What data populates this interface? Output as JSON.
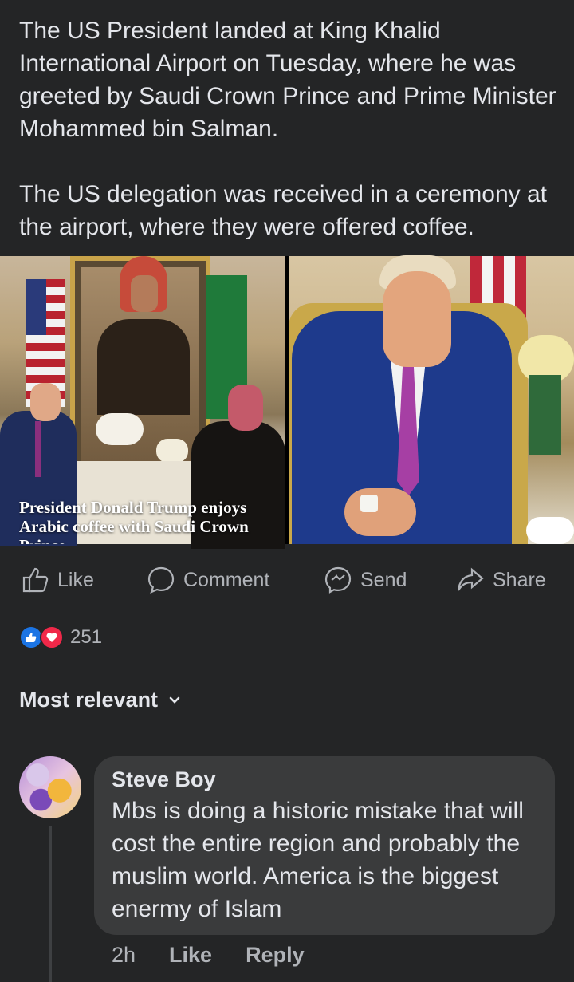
{
  "post": {
    "caption_p1": "The US President landed at King Khalid International Airport on Tuesday, where he was greeted by Saudi Crown Prince and Prime Minister Mohammed bin Salman.",
    "caption_p2": "The US delegation was received in a ceremony at the airport, where they were offered coffee.",
    "photo_overlay_text": "President Donald Trump enjoys Arabic coffee with Saudi Crown Prince"
  },
  "actions": {
    "like": "Like",
    "comment": "Comment",
    "send": "Send",
    "share": "Share"
  },
  "reactions": {
    "count": "251",
    "types": [
      "like-icon",
      "love-icon"
    ]
  },
  "comments_section": {
    "sort_label": "Most relevant"
  },
  "comment": {
    "author": "Steve Boy",
    "text": "Mbs is doing a historic mistake that will cost the entire region and probably the muslim world. America is the biggest enermy of Islam",
    "time": "2h",
    "like": "Like",
    "reply": "Reply"
  },
  "colors": {
    "background": "#242526",
    "text": "#e4e6eb",
    "muted": "#b0b3b8",
    "bubble": "#3a3b3c",
    "like_blue": "#1b74e4",
    "love_red": "#f02849"
  }
}
